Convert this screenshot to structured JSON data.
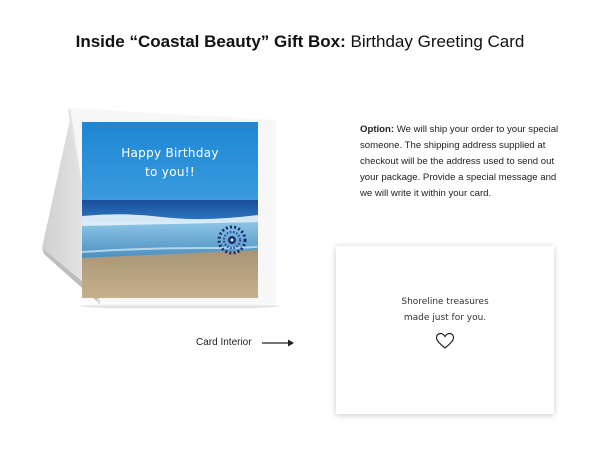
{
  "heading": {
    "bold": "Inside “Coastal Beauty” Gift Box:",
    "rest": " Birthday Greeting Card"
  },
  "card": {
    "greeting_line1": "Happy Birthday",
    "greeting_line2": "to you!!"
  },
  "option": {
    "label": "Option:",
    "text": " We will ship your order to your special someone. The shipping address supplied at checkout will be the address used to send out your package. Provide a special message and we will write it within your card."
  },
  "interior": {
    "line1": "Shoreline treasures",
    "line2": "made just for you.",
    "label": "Card Interior"
  },
  "colors": {
    "sky": "#2d8fd6",
    "ocean": "#1d5fa8",
    "sand": "#b49b7a"
  },
  "icons": [
    "heart-icon",
    "arrow-right-icon",
    "sea-urchin-icon"
  ]
}
